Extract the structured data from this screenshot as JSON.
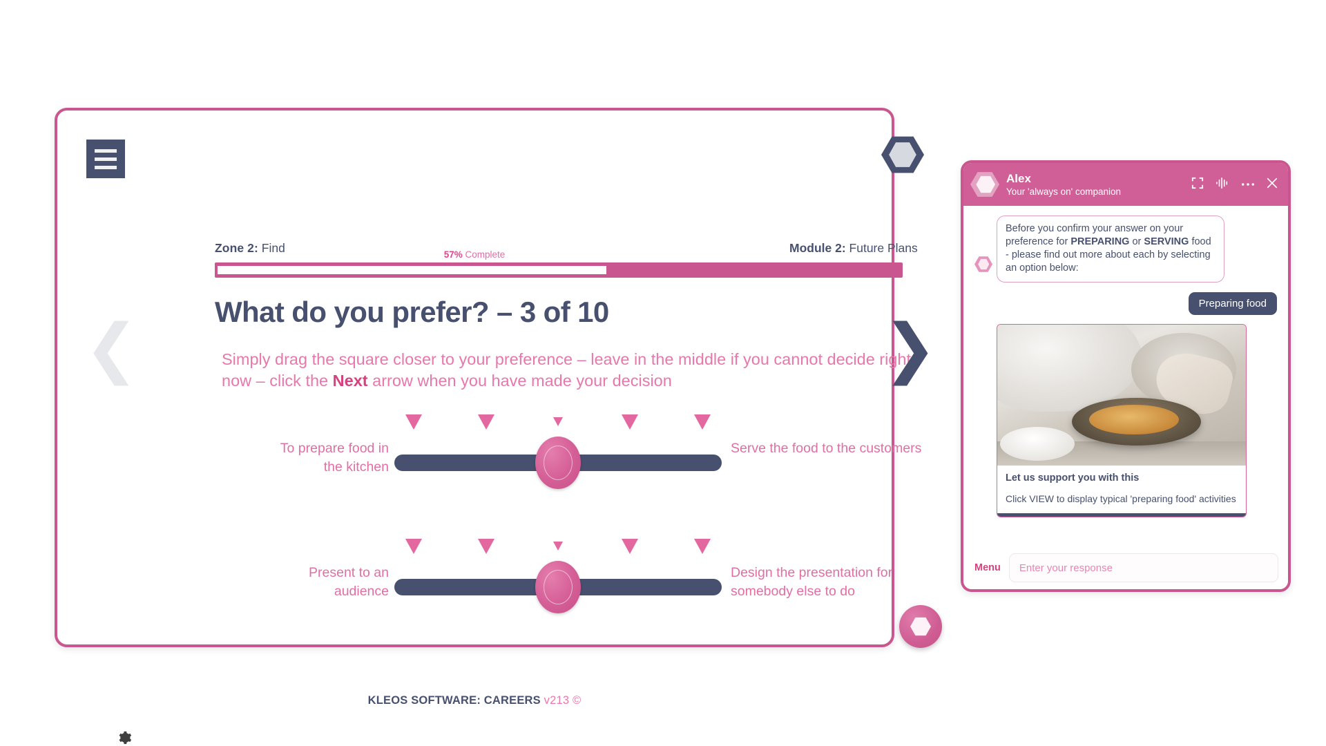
{
  "course": {
    "zone_prefix": "Zone 2:",
    "zone_name": " Find",
    "module_prefix": "Module 2:",
    "module_name": " Future Plans",
    "progress_percent": "57%",
    "progress_complete_label": " Complete",
    "progress_value": 57,
    "title": "What do you prefer? – 3 of 10",
    "instruction_part1": "Simply drag the  square closer to your preference – leave in the middle if you cannot decide right now – click the ",
    "instruction_bold": "Next",
    "instruction_part2": " arrow when you have made your decision",
    "footer_brand": "KLEOS SOFTWARE: CAREERS",
    "footer_version": "v213 ©",
    "nav_prev": "❮",
    "nav_next": "❯",
    "accent_pink": "#c9568e",
    "accent_navy": "#47506e"
  },
  "sliders": [
    {
      "left_label": "To prepare food in the kitchen",
      "right_label": "Serve the food to the customers",
      "value": 50
    },
    {
      "left_label": "Present to an audience",
      "right_label": "Design the presentation for somebody else to do",
      "value": 50
    }
  ],
  "chat": {
    "title": "Alex",
    "subtitle": "Your 'always on' companion",
    "icons": {
      "expand": "expand-icon",
      "voice": "waveform-icon",
      "more": "ellipsis-icon",
      "close": "close-icon"
    },
    "bot_message": {
      "part1": "Before you confirm your answer on your preference for ",
      "bold1": "PREPARING",
      "part2": " or ",
      "bold2": "SERVING",
      "part3": " food - please find out more about each by selecting an option below:"
    },
    "user_message": "Preparing food",
    "card": {
      "title": "Let us support you with this",
      "text": "Click VIEW to display typical 'preparing food' activities"
    },
    "menu_label": "Menu",
    "input_placeholder": "Enter your response",
    "input_value": ""
  }
}
